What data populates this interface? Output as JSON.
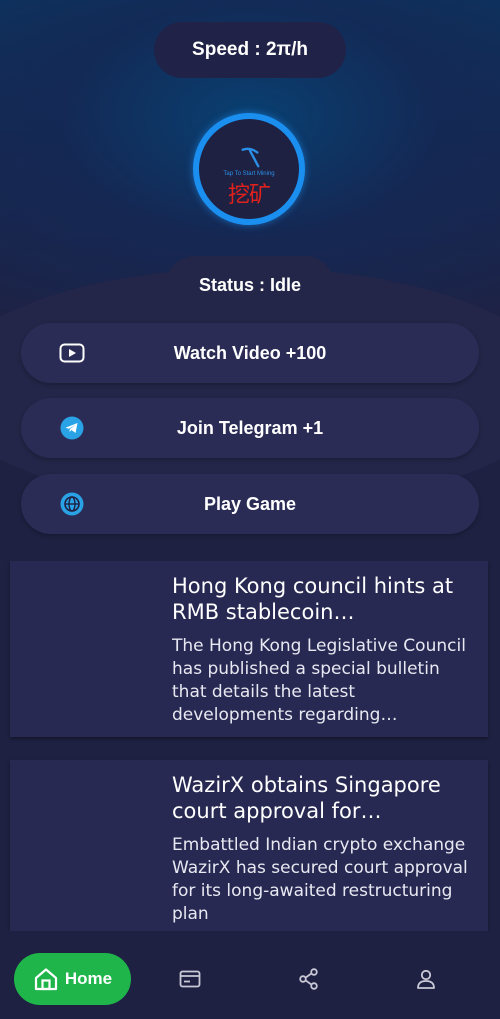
{
  "speed": {
    "label": "Speed : 2π/h"
  },
  "mining": {
    "tap_text": "Tap To Start Mining",
    "button_text": "挖矿",
    "ring_color": "#1a8ff0",
    "text_color": "#e0211c"
  },
  "status": {
    "label": "Status : Idle"
  },
  "actions": [
    {
      "label": "Watch Video +100",
      "icon": "video-play-icon"
    },
    {
      "label": "Join Telegram +1",
      "icon": "telegram-icon"
    },
    {
      "label": "Play Game",
      "icon": "globe-icon"
    }
  ],
  "news": [
    {
      "title": "Hong Kong council hints at RMB stablecoin development",
      "body": "The Hong Kong Legislative Council has published a special bulletin that details the latest developments regarding stablecoins"
    },
    {
      "title": "WazirX obtains Singapore court approval for restructuring",
      "body": "Embattled Indian crypto exchange WazirX has secured court approval for its long-awaited restructuring plan"
    }
  ],
  "nav": {
    "home_label": "Home",
    "items": [
      "home-icon",
      "wallet-card-icon",
      "share-icon",
      "profile-icon"
    ],
    "active_color": "#1fb54a"
  }
}
